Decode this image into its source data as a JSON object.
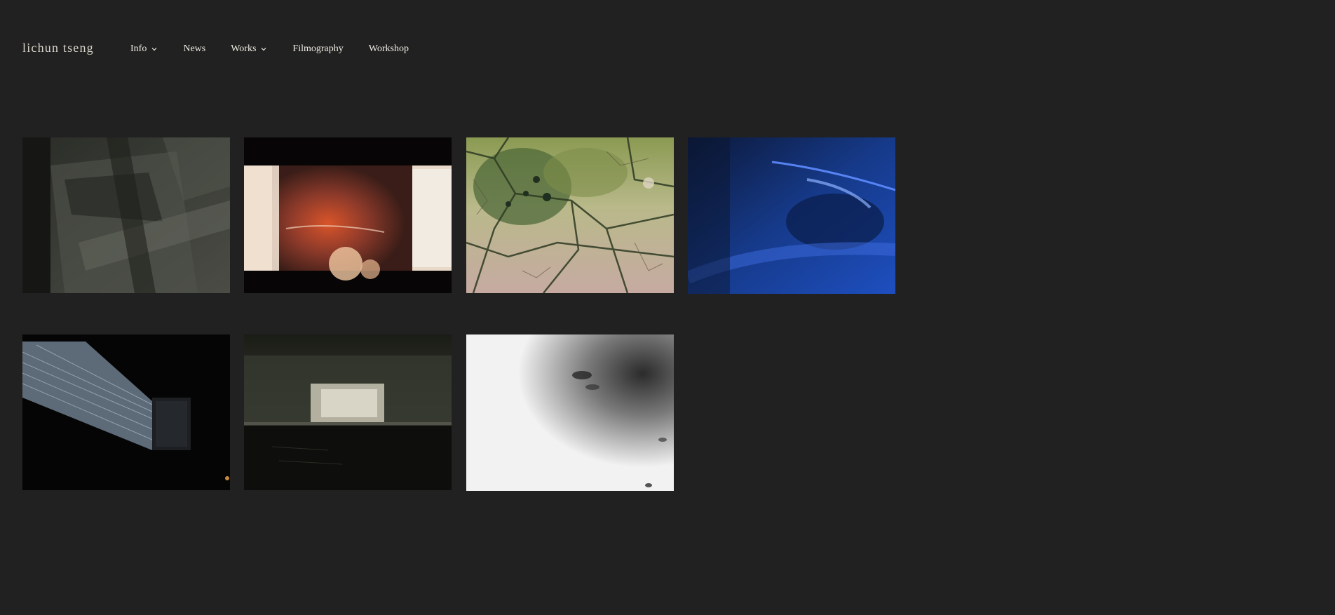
{
  "site": {
    "title": "lichun tseng"
  },
  "nav": {
    "items": [
      {
        "label": "Info",
        "has_dropdown": true
      },
      {
        "label": "News",
        "has_dropdown": false
      },
      {
        "label": "Works",
        "has_dropdown": true
      },
      {
        "label": "Filmography",
        "has_dropdown": false
      },
      {
        "label": "Workshop",
        "has_dropdown": false
      }
    ]
  },
  "gallery": {
    "thumbnails": [
      {
        "palette": "dark-grey-abstract"
      },
      {
        "palette": "warm-orange-film"
      },
      {
        "palette": "green-cracked-texture"
      },
      {
        "palette": "deep-blue-light"
      },
      {
        "palette": "black-installation-light"
      },
      {
        "palette": "dark-water-projection"
      },
      {
        "palette": "white-grain-texture"
      }
    ]
  },
  "colors": {
    "background": "#212121",
    "text": "#f0ece4"
  }
}
